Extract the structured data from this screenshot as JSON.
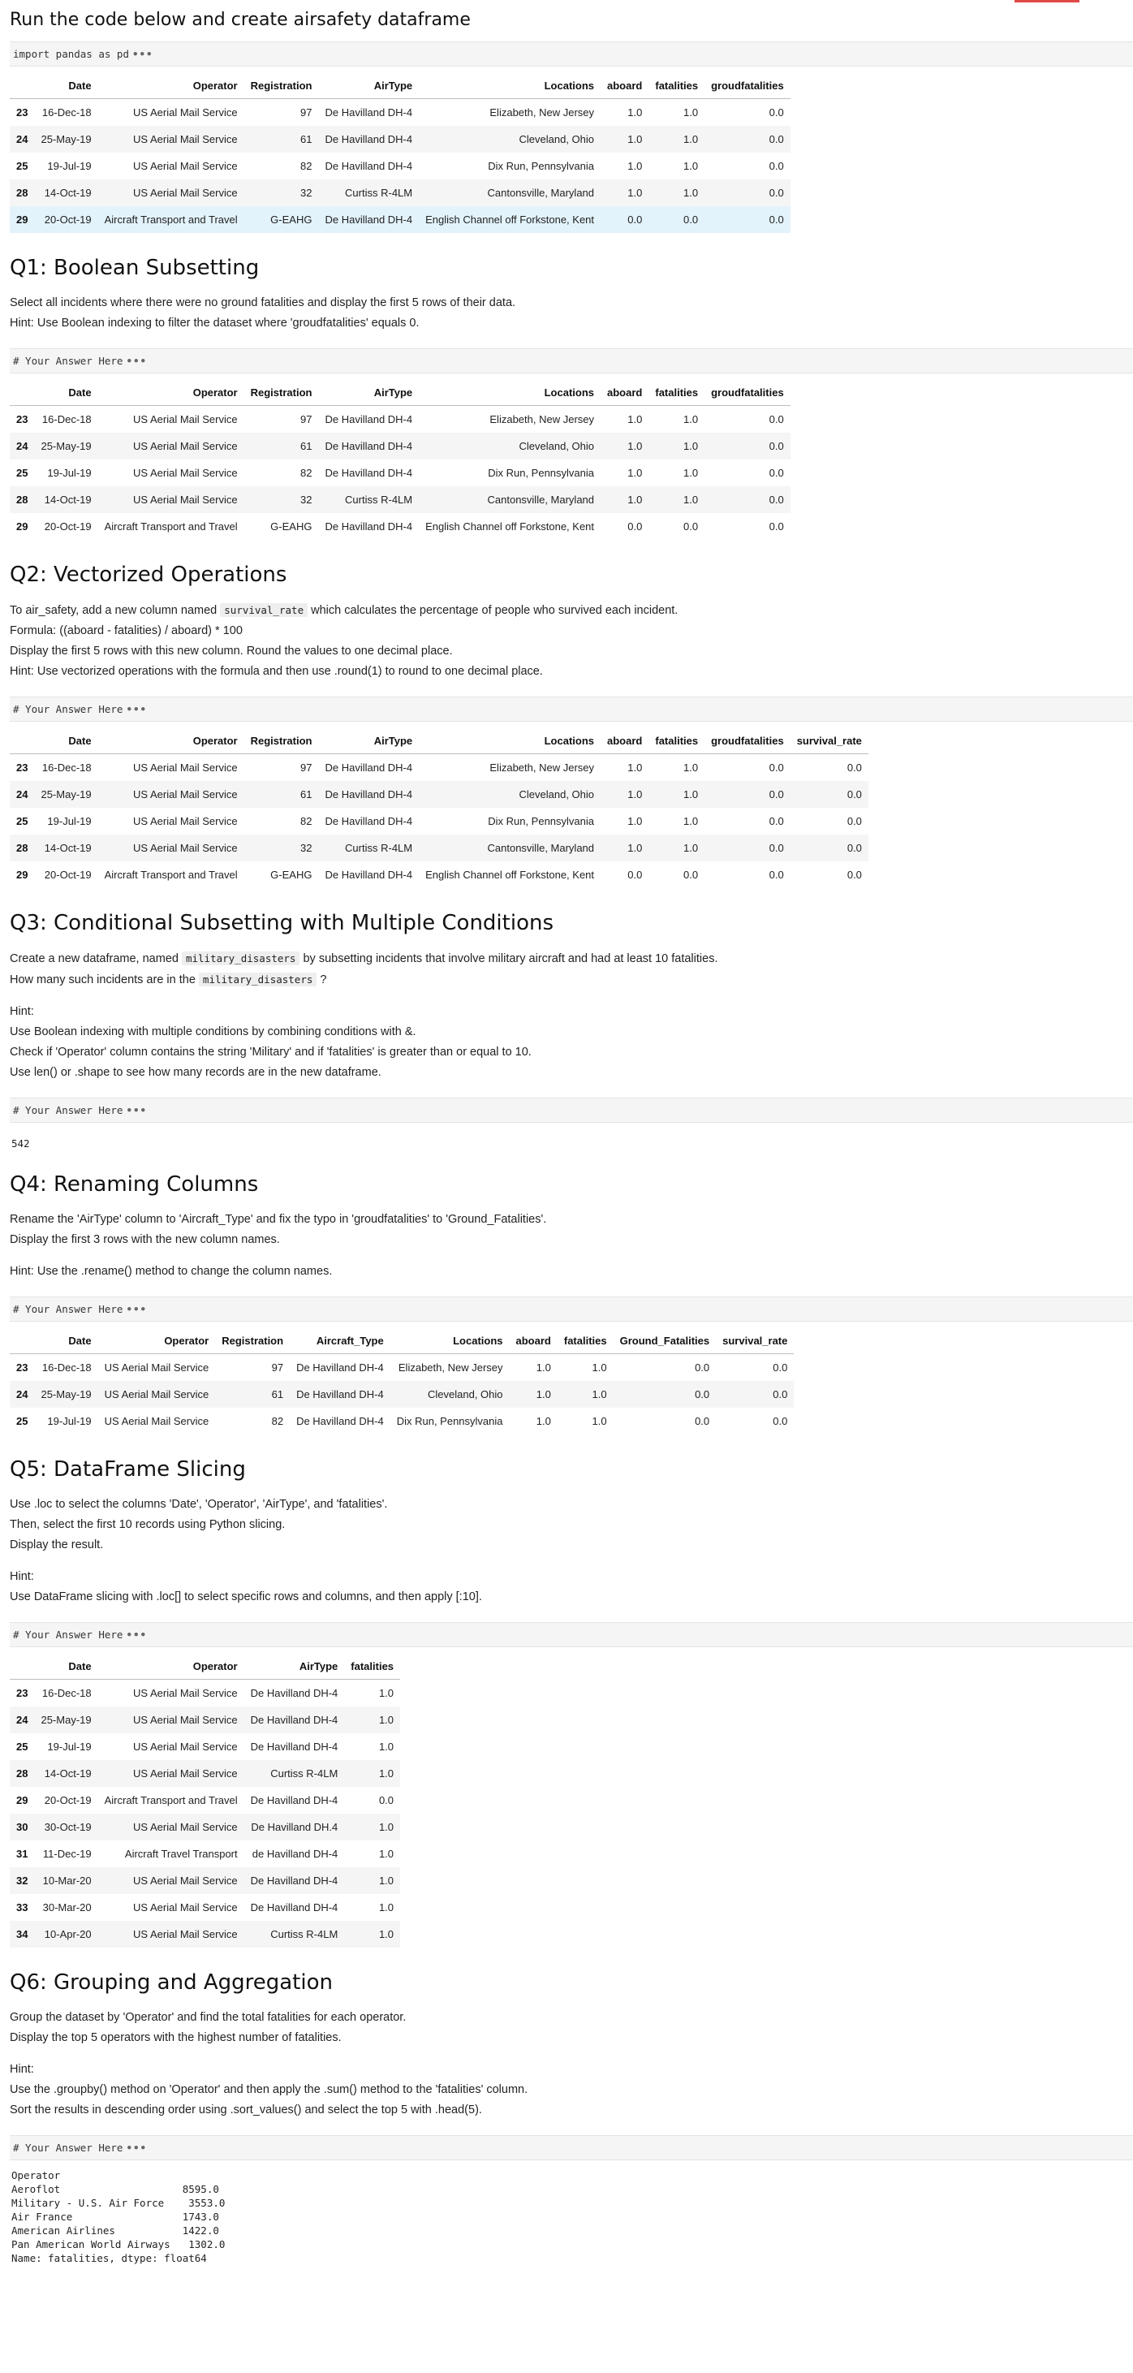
{
  "title": "Run the code below and create airsafety dataframe",
  "setup_code": "import pandas as pd",
  "cols_main": [
    "",
    "Date",
    "Operator",
    "Registration",
    "AirType",
    "Locations",
    "aboard",
    "fatalities",
    "groudfatalities"
  ],
  "rows_main": [
    [
      "23",
      "16-Dec-18",
      "US Aerial Mail Service",
      "97",
      "De Havilland DH-4",
      "Elizabeth, New Jersey",
      "1.0",
      "1.0",
      "0.0"
    ],
    [
      "24",
      "25-May-19",
      "US Aerial Mail Service",
      "61",
      "De Havilland DH-4",
      "Cleveland, Ohio",
      "1.0",
      "1.0",
      "0.0"
    ],
    [
      "25",
      "19-Jul-19",
      "US Aerial Mail Service",
      "82",
      "De Havilland DH-4",
      "Dix Run, Pennsylvania",
      "1.0",
      "1.0",
      "0.0"
    ],
    [
      "28",
      "14-Oct-19",
      "US Aerial Mail Service",
      "32",
      "Curtiss R-4LM",
      "Cantonsville, Maryland",
      "1.0",
      "1.0",
      "0.0"
    ],
    [
      "29",
      "20-Oct-19",
      "Aircraft Transport and Travel",
      "G-EAHG",
      "De Havilland DH-4",
      "English Channel off Forkstone, Kent",
      "0.0",
      "0.0",
      "0.0"
    ]
  ],
  "answer_code": "# Your Answer Here",
  "q1": {
    "title": "Q1: Boolean Subsetting",
    "line1": "Select all incidents where there were no ground fatalities and display the first 5 rows of their data.",
    "line2": "Hint: Use Boolean indexing to filter the dataset where 'groudfatalities' equals 0."
  },
  "q2": {
    "title": "Q2: Vectorized Operations",
    "line1_pre": "To air_safety, add a new column named ",
    "line1_code": "survival_rate",
    "line1_post": " which calculates the percentage of people who survived each incident.",
    "line2": "Formula: ((aboard - fatalities) / aboard) * 100",
    "line3": "Display the first 5 rows with this new column. Round the values to one decimal place.",
    "line4": "Hint: Use vectorized operations with the formula and then use .round(1) to round to one decimal place.",
    "cols": [
      "",
      "Date",
      "Operator",
      "Registration",
      "AirType",
      "Locations",
      "aboard",
      "fatalities",
      "groudfatalities",
      "survival_rate"
    ],
    "rows": [
      [
        "23",
        "16-Dec-18",
        "US Aerial Mail Service",
        "97",
        "De Havilland DH-4",
        "Elizabeth, New Jersey",
        "1.0",
        "1.0",
        "0.0",
        "0.0"
      ],
      [
        "24",
        "25-May-19",
        "US Aerial Mail Service",
        "61",
        "De Havilland DH-4",
        "Cleveland, Ohio",
        "1.0",
        "1.0",
        "0.0",
        "0.0"
      ],
      [
        "25",
        "19-Jul-19",
        "US Aerial Mail Service",
        "82",
        "De Havilland DH-4",
        "Dix Run, Pennsylvania",
        "1.0",
        "1.0",
        "0.0",
        "0.0"
      ],
      [
        "28",
        "14-Oct-19",
        "US Aerial Mail Service",
        "32",
        "Curtiss R-4LM",
        "Cantonsville, Maryland",
        "1.0",
        "1.0",
        "0.0",
        "0.0"
      ],
      [
        "29",
        "20-Oct-19",
        "Aircraft Transport and Travel",
        "G-EAHG",
        "De Havilland DH-4",
        "English Channel off Forkstone, Kent",
        "0.0",
        "0.0",
        "0.0",
        "0.0"
      ]
    ]
  },
  "q3": {
    "title": "Q3: Conditional Subsetting with Multiple Conditions",
    "line1_pre": "Create a new dataframe, named ",
    "line1_code": "military_disasters",
    "line1_post": " by subsetting incidents that involve military aircraft and had at least 10 fatalities.",
    "line2_pre": "How many such incidents are in the ",
    "line2_code": "military_disasters",
    "line2_post": " ?",
    "hint": "Hint:",
    "hint1": "Use Boolean indexing with multiple conditions by combining conditions with &.",
    "hint2": "Check if 'Operator' column contains the string 'Military' and if 'fatalities' is greater than or equal to 10.",
    "hint3": "Use len() or .shape to see how many records are in the new dataframe.",
    "output": "542"
  },
  "q4": {
    "title": "Q4: Renaming Columns",
    "line1": "Rename the 'AirType' column to 'Aircraft_Type' and fix the typo in 'groudfatalities' to 'Ground_Fatalities'.",
    "line2": "Display the first 3 rows with the new column names.",
    "hint": "Hint: Use the .rename() method to change the column names.",
    "cols": [
      "",
      "Date",
      "Operator",
      "Registration",
      "Aircraft_Type",
      "Locations",
      "aboard",
      "fatalities",
      "Ground_Fatalities",
      "survival_rate"
    ],
    "rows": [
      [
        "23",
        "16-Dec-18",
        "US Aerial Mail Service",
        "97",
        "De Havilland DH-4",
        "Elizabeth, New Jersey",
        "1.0",
        "1.0",
        "0.0",
        "0.0"
      ],
      [
        "24",
        "25-May-19",
        "US Aerial Mail Service",
        "61",
        "De Havilland DH-4",
        "Cleveland, Ohio",
        "1.0",
        "1.0",
        "0.0",
        "0.0"
      ],
      [
        "25",
        "19-Jul-19",
        "US Aerial Mail Service",
        "82",
        "De Havilland DH-4",
        "Dix Run, Pennsylvania",
        "1.0",
        "1.0",
        "0.0",
        "0.0"
      ]
    ]
  },
  "q5": {
    "title": "Q5: DataFrame Slicing",
    "line1": "Use .loc to select the columns 'Date', 'Operator', 'AirType', and 'fatalities'.",
    "line2": "Then, select the first 10 records using Python slicing.",
    "line3": "Display the result.",
    "hint": "Hint:",
    "hint1": "Use DataFrame slicing with .loc[] to select specific rows and columns, and then apply [:10].",
    "cols": [
      "",
      "Date",
      "Operator",
      "AirType",
      "fatalities"
    ],
    "rows": [
      [
        "23",
        "16-Dec-18",
        "US Aerial Mail Service",
        "De Havilland DH-4",
        "1.0"
      ],
      [
        "24",
        "25-May-19",
        "US Aerial Mail Service",
        "De Havilland DH-4",
        "1.0"
      ],
      [
        "25",
        "19-Jul-19",
        "US Aerial Mail Service",
        "De Havilland DH-4",
        "1.0"
      ],
      [
        "28",
        "14-Oct-19",
        "US Aerial Mail Service",
        "Curtiss R-4LM",
        "1.0"
      ],
      [
        "29",
        "20-Oct-19",
        "Aircraft Transport and Travel",
        "De Havilland DH-4",
        "0.0"
      ],
      [
        "30",
        "30-Oct-19",
        "US Aerial Mail Service",
        "De Havilland DH.4",
        "1.0"
      ],
      [
        "31",
        "11-Dec-19",
        "Aircraft Travel Transport",
        "de Havilland DH-4",
        "1.0"
      ],
      [
        "32",
        "10-Mar-20",
        "US Aerial Mail Service",
        "De Havilland DH-4",
        "1.0"
      ],
      [
        "33",
        "30-Mar-20",
        "US Aerial Mail Service",
        "De Havilland DH-4",
        "1.0"
      ],
      [
        "34",
        "10-Apr-20",
        "US Aerial Mail Service",
        "Curtiss R-4LM",
        "1.0"
      ]
    ]
  },
  "q6": {
    "title": "Q6: Grouping and Aggregation",
    "line1": "Group the dataset by 'Operator' and find the total fatalities for each operator.",
    "line2": "Display the top 5 operators with the highest number of fatalities.",
    "hint": "Hint:",
    "hint1": "Use the .groupby() method on 'Operator' and then apply the .sum() method to the 'fatalities' column.",
    "hint2": "Sort the results in descending order using .sort_values() and select the top 5 with .head(5).",
    "output": "Operator\nAeroflot                    8595.0\nMilitary - U.S. Air Force    3553.0\nAir France                  1743.0\nAmerican Airlines           1422.0\nPan American World Airways   1302.0\nName: fatalities, dtype: float64"
  },
  "colors": {
    "accent": "#e04848",
    "row_stripe": "#f5f5f5",
    "row_highlight": "#e3f3fb",
    "code_bg": "#f5f5f5"
  }
}
